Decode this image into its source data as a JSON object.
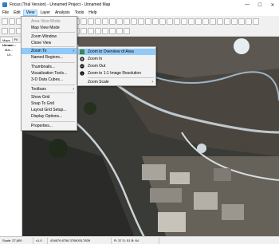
{
  "window": {
    "title": "Focus (Trial Version) - Unnamed Project - Unnamed Map",
    "minimize": "—",
    "maximize": "☐",
    "close": "✕"
  },
  "menubar": [
    "File",
    "Edit",
    "View",
    "Layer",
    "Analysis",
    "Tools",
    "Help"
  ],
  "left_panel": {
    "tabs": [
      "Maps",
      "Fil"
    ],
    "tree": [
      "Unnam...",
      "Mar...",
      "Ur..."
    ]
  },
  "view_menu": {
    "items": [
      {
        "label": "Area View Mode",
        "disabled": true
      },
      {
        "label": "Map View Mode"
      },
      {
        "label": "Zoom Window"
      },
      {
        "label": "Clone View"
      },
      {
        "label": "Zoom To",
        "submenu": true,
        "highlighted": true
      },
      {
        "label": "Named Regions..."
      },
      {
        "label": "Thumbnails..."
      },
      {
        "label": "Visualization Tools..."
      },
      {
        "label": "3-D Data Cubes..."
      },
      {
        "label": "Toolbars",
        "submenu": true
      },
      {
        "label": "Show Grid"
      },
      {
        "label": "Snap To Grid"
      },
      {
        "label": "Layout Grid Setup..."
      },
      {
        "label": "Display Options..."
      },
      {
        "label": "Properties..."
      }
    ]
  },
  "zoom_menu": {
    "items": [
      {
        "label": "Zoom to Overview of Area",
        "highlighted": true
      },
      {
        "label": "Zoom In"
      },
      {
        "label": "Zoom Out"
      },
      {
        "label": "Zoom to 1:1 Image Resolution"
      },
      {
        "label": "Zoom Scale",
        "submenu": true
      }
    ]
  },
  "statusbar": {
    "scale": "Scale: 27,600",
    "zoom": "x1.0",
    "coords": "434679.8756 3706003.7839",
    "pixel": "R: 37 G: 51 B: 64"
  }
}
